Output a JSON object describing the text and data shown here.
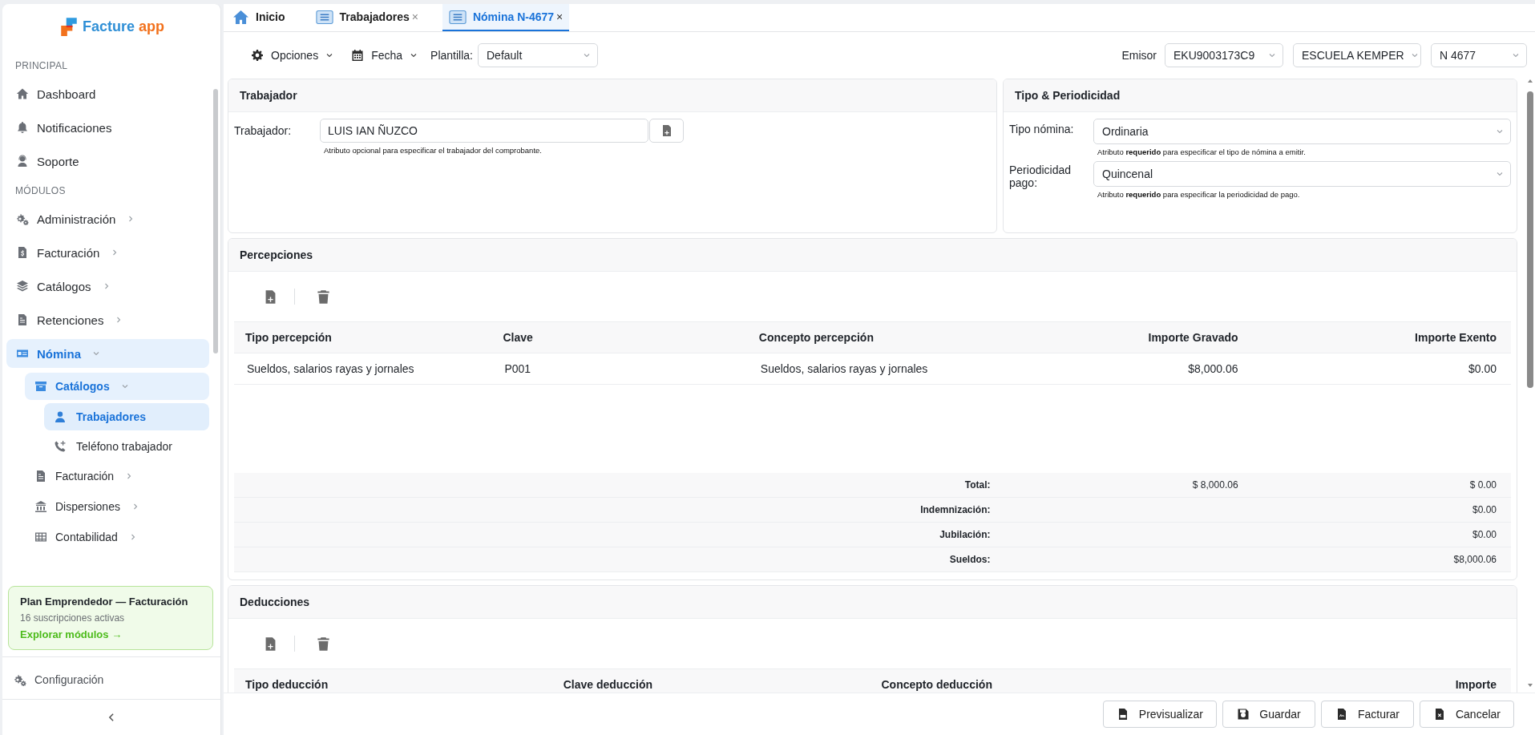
{
  "sidebar": {
    "logo_name": "Facture",
    "logo_suffix": "app",
    "sections": [
      {
        "title": "PRINCIPAL",
        "items": [
          {
            "label": "Dashboard"
          },
          {
            "label": "Notificaciones"
          },
          {
            "label": "Soporte"
          }
        ]
      },
      {
        "title": "MÓDULOS",
        "items": [
          {
            "label": "Administración",
            "expanded": false
          },
          {
            "label": "Facturación",
            "expanded": false
          },
          {
            "label": "Catálogos",
            "expanded": false
          },
          {
            "label": "Retenciones",
            "expanded": false
          },
          {
            "label": "Nómina",
            "expanded": true,
            "children": [
              {
                "label": "Catálogos",
                "expanded": true,
                "children": [
                  {
                    "label": "Trabajadores",
                    "selected": true
                  },
                  {
                    "label": "Teléfono trabajador",
                    "selected": false
                  }
                ]
              },
              {
                "label": "Facturación",
                "expanded": false
              },
              {
                "label": "Dispersiones",
                "expanded": false
              },
              {
                "label": "Contabilidad",
                "expanded": false
              }
            ]
          }
        ]
      }
    ],
    "plan": {
      "title": "Plan Emprendedor — Facturación",
      "subtitle": "16 suscripciones activas",
      "link": "Explorar módulos →"
    },
    "footer_item": "Configuración"
  },
  "tabs": [
    {
      "label": "Inicio",
      "selected": false
    },
    {
      "label": "Trabajadores",
      "close": "×",
      "selected": false
    },
    {
      "label": "Nómina N-4677",
      "close": "×",
      "selected": true
    }
  ],
  "toolbar": {
    "menus": [
      "Opciones",
      "Fecha"
    ],
    "plantilla": {
      "label": "Plantilla:",
      "value": "Default"
    },
    "emisor": {
      "label": "Emisor",
      "selects": [
        "EKU9003173C9",
        "ESCUELA KEMPER",
        "N 4677"
      ]
    }
  },
  "trabajador": {
    "title": "Trabajador",
    "label": "Trabajador:",
    "value": "LUIS IAN ÑUZCO",
    "hint": "Atributo opcional para especificar el trabajador del comprobante."
  },
  "tipo_periodicidad": {
    "title": "Tipo & Periodicidad",
    "fields": [
      {
        "label": "Tipo nómina:",
        "value": "Ordinaria",
        "hint": "Atributo **requerido** para especificar el tipo de nómina a emitir."
      },
      {
        "label": "Periodicidad pago:",
        "value": "Quincenal",
        "hint": "Atributo **requerido** para especificar la periodicidad de pago."
      }
    ]
  },
  "percepciones": {
    "title": "Percepciones",
    "columns": [
      "Tipo percepción",
      "Clave",
      "Concepto percepción",
      "Importe Gravado",
      "Importe Exento"
    ],
    "rows": [
      [
        "Sueldos, salarios rayas y jornales",
        "P001",
        "Sueldos, salarios rayas y jornales",
        "$8,000.06",
        "$0.00"
      ]
    ],
    "totals": [
      {
        "label": "Total:",
        "gravado": "$ 8,000.06",
        "exento": "$ 0.00"
      },
      {
        "label": "Indemnización:",
        "exento": "$0.00"
      },
      {
        "label": "Jubilación:",
        "exento": "$0.00"
      },
      {
        "label": "Sueldos:",
        "exento": "$8,000.06"
      }
    ]
  },
  "deducciones": {
    "title": "Deducciones",
    "columns": [
      "Tipo deducción",
      "Clave deducción",
      "Concepto deducción",
      "Importe"
    ]
  },
  "actions": [
    "Previsualizar",
    "Guardar",
    "Facturar",
    "Cancelar"
  ]
}
